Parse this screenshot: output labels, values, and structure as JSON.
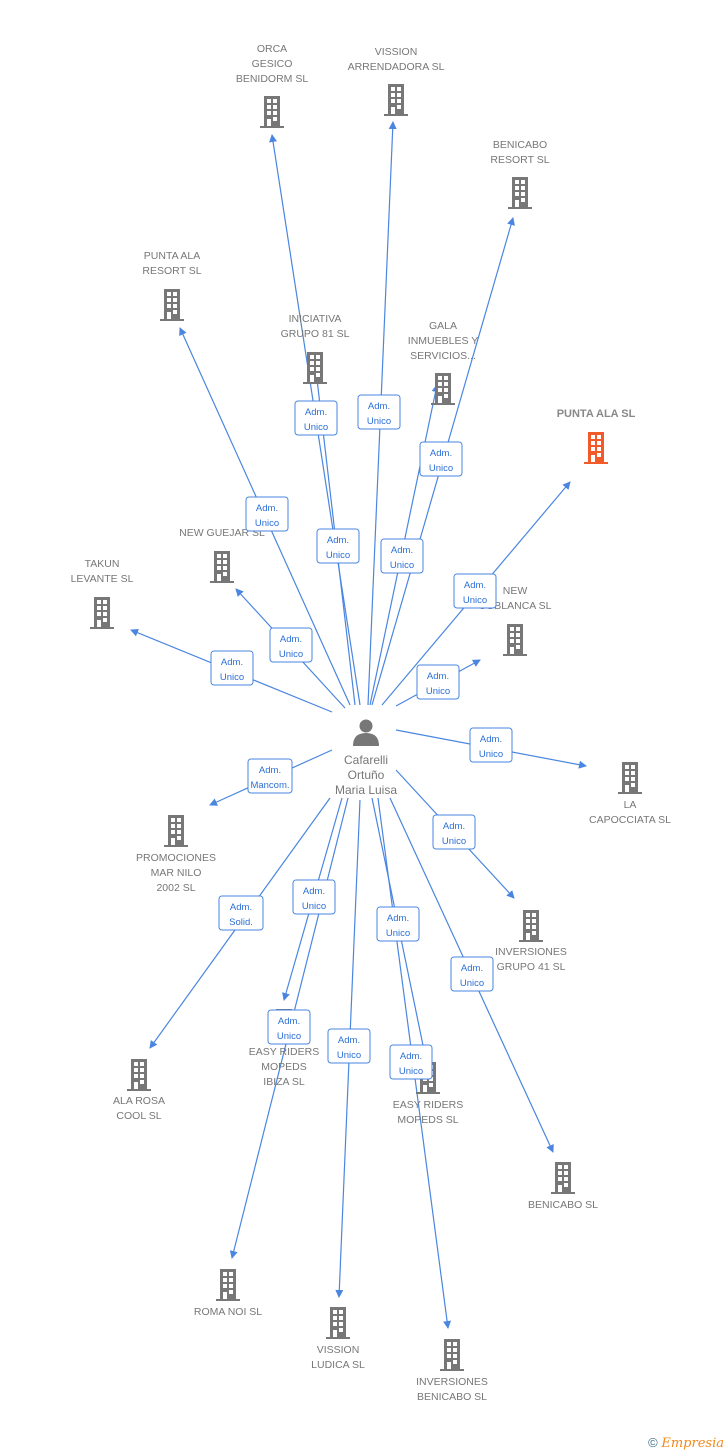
{
  "colors": {
    "edge": "#4a86e0",
    "building": "#777777",
    "highlight": "#f25a2a",
    "person": "#777777"
  },
  "person": {
    "name_lines": [
      "Cafarelli",
      "Ortuño",
      "Maria Luisa"
    ],
    "icon": "person-icon"
  },
  "companies": [
    {
      "lines": [
        "ORCA",
        "GESICO",
        "BENIDORM SL"
      ],
      "role": [
        "Adm.",
        "Unico"
      ]
    },
    {
      "lines": [
        "VISSION",
        "ARRENDADORA SL"
      ],
      "role": [
        "Adm.",
        "Unico"
      ]
    },
    {
      "lines": [
        "BENICABO",
        "RESORT SL"
      ],
      "role": [
        "Adm.",
        "Unico"
      ]
    },
    {
      "lines": [
        "PUNTA ALA",
        "RESORT SL"
      ],
      "role": [
        "Adm.",
        "Unico"
      ]
    },
    {
      "lines": [
        "INICIATIVA",
        "GRUPO 81  SL"
      ],
      "role": [
        "Adm.",
        "Unico"
      ]
    },
    {
      "lines": [
        "GALA",
        "INMUEBLES Y",
        "SERVICIOS..."
      ],
      "role": [
        "Adm.",
        "Unico"
      ]
    },
    {
      "lines": [
        "PUNTA ALA SL"
      ],
      "role": [
        "Adm.",
        "Unico"
      ],
      "highlight": true
    },
    {
      "lines": [
        "NEW GUEJAR SL"
      ],
      "role": [
        "Adm.",
        "Unico"
      ]
    },
    {
      "lines": [
        "TAKUN",
        "LEVANTE SL"
      ],
      "role": [
        "Adm.",
        "Unico"
      ]
    },
    {
      "lines": [
        "NEW",
        "COBLANCA SL"
      ],
      "role": [
        "Adm.",
        "Unico"
      ]
    },
    {
      "lines": [
        "LA",
        "CAPOCCIATA SL"
      ],
      "role": [
        "Adm.",
        "Unico"
      ]
    },
    {
      "lines": [
        "PROMOCIONES",
        "MAR NILO",
        "2002 SL"
      ],
      "role": [
        "Adm.",
        "Mancom."
      ]
    },
    {
      "lines": [
        "INVERSIONES",
        "GRUPO 41 SL"
      ],
      "role": [
        "Adm.",
        "Unico"
      ]
    },
    {
      "lines": [
        "ALA ROSA",
        "COOL SL"
      ],
      "role": [
        "Adm.",
        "Solid."
      ]
    },
    {
      "lines": [
        "EASY RIDERS",
        "MOPEDS",
        "IBIZA SL"
      ],
      "role": [
        "Adm.",
        "Unico"
      ]
    },
    {
      "lines": [
        "ROMA NOI SL"
      ],
      "role": [
        "Adm.",
        "Unico"
      ]
    },
    {
      "lines": [
        "VISSION",
        "LUDICA SL"
      ],
      "role": [
        "Adm.",
        "Unico"
      ]
    },
    {
      "lines": [
        "EASY RIDERS",
        "MOPEDS SL"
      ],
      "role": [
        "Adm.",
        "Unico"
      ]
    },
    {
      "lines": [
        "BENICABO SL"
      ],
      "role": [
        "Adm.",
        "Unico"
      ]
    },
    {
      "lines": [
        "INVERSIONES",
        "BENICABO SL"
      ],
      "role": [
        "Adm.",
        "Unico"
      ]
    }
  ],
  "footer": {
    "copyright": "©",
    "brand": "Empresia"
  }
}
